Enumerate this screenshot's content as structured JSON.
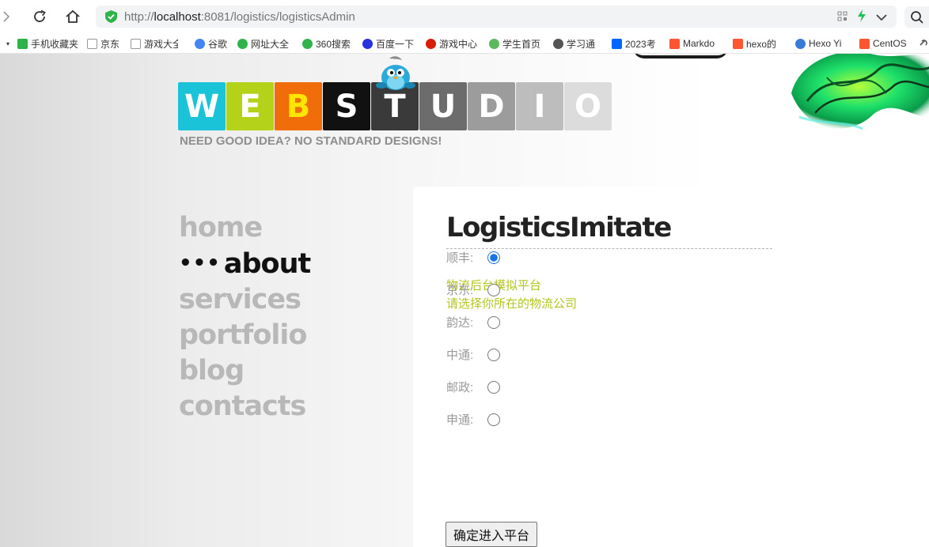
{
  "browser": {
    "url_scheme": "http://",
    "url_host": "localhost",
    "url_rest": ":8081/logistics/logisticsAdmin",
    "bookmarks": [
      {
        "label": "手机收藏夹",
        "icon": "phone-icon",
        "color": "#2db34a"
      },
      {
        "label": "京东",
        "icon": "page-icon",
        "color": "#999999"
      },
      {
        "label": "游戏大全",
        "icon": "page-icon",
        "color": "#999999"
      },
      {
        "label": "谷歌",
        "icon": "google-icon",
        "color": "#4285f4"
      },
      {
        "label": "网址大全",
        "icon": "360-icon",
        "color": "#2fb34a"
      },
      {
        "label": "360搜索",
        "icon": "search360-icon",
        "color": "#2fb34a"
      },
      {
        "label": "百度一下",
        "icon": "baidu-icon",
        "color": "#2932e1"
      },
      {
        "label": "游戏中心",
        "icon": "game-icon",
        "color": "#d81e06"
      },
      {
        "label": "学生首页",
        "icon": "chart-icon",
        "color": "#5cb85c"
      },
      {
        "label": "学习通",
        "icon": "globe-icon",
        "color": "#555555"
      },
      {
        "label": "2023考",
        "icon": "zhihu-icon",
        "color": "#0066ff"
      },
      {
        "label": "Markdo",
        "icon": "csdn-icon",
        "color": "#fc5531"
      },
      {
        "label": "hexo的",
        "icon": "csdn-icon",
        "color": "#fc5531"
      },
      {
        "label": "Hexo Yi",
        "icon": "hexo-icon",
        "color": "#3a7bd5"
      },
      {
        "label": "CentOS",
        "icon": "csdn-icon",
        "color": "#fc5531"
      }
    ]
  },
  "logo": {
    "letters": [
      {
        "char": "W",
        "bg": "#1bc3d9",
        "fg": "#ffffff"
      },
      {
        "char": "E",
        "bg": "#b4d21a",
        "fg": "#ffffff"
      },
      {
        "char": "B",
        "bg": "#f06d0a",
        "fg": "#ffe600"
      },
      {
        "char": "S",
        "bg": "#111111",
        "fg": "#ffffff"
      },
      {
        "char": "T",
        "bg": "#3a3a3a",
        "fg": "#ffffff"
      },
      {
        "char": "U",
        "bg": "#6c6c6c",
        "fg": "#ffffff"
      },
      {
        "char": "D",
        "bg": "#9c9c9c",
        "fg": "#ffffff"
      },
      {
        "char": "I",
        "bg": "#bdbdbd",
        "fg": "#ffffff"
      },
      {
        "char": "O",
        "bg": "#dcdcdc",
        "fg": "#ffffff"
      }
    ],
    "tagline": "NEED GOOD IDEA? NO STANDARD DESIGNS!"
  },
  "menu": {
    "items": [
      "home",
      "about",
      "services",
      "portfolio",
      "blog",
      "contacts"
    ],
    "active_marker": "•••"
  },
  "content": {
    "title": "LogisticsImitate",
    "intro_line1": "物流后台模拟平台",
    "intro_line2": "请选择你所在的物流公司",
    "companies": [
      "顺丰:",
      "京东:",
      "韵达:",
      "中通:",
      "邮政:",
      "申通:"
    ],
    "selected_company": "顺丰:",
    "submit_label": "确定进入平台"
  },
  "colors": {
    "intro_text": "#b3c51e",
    "menu_inactive": "#b8b8b8",
    "menu_active": "#111111"
  }
}
